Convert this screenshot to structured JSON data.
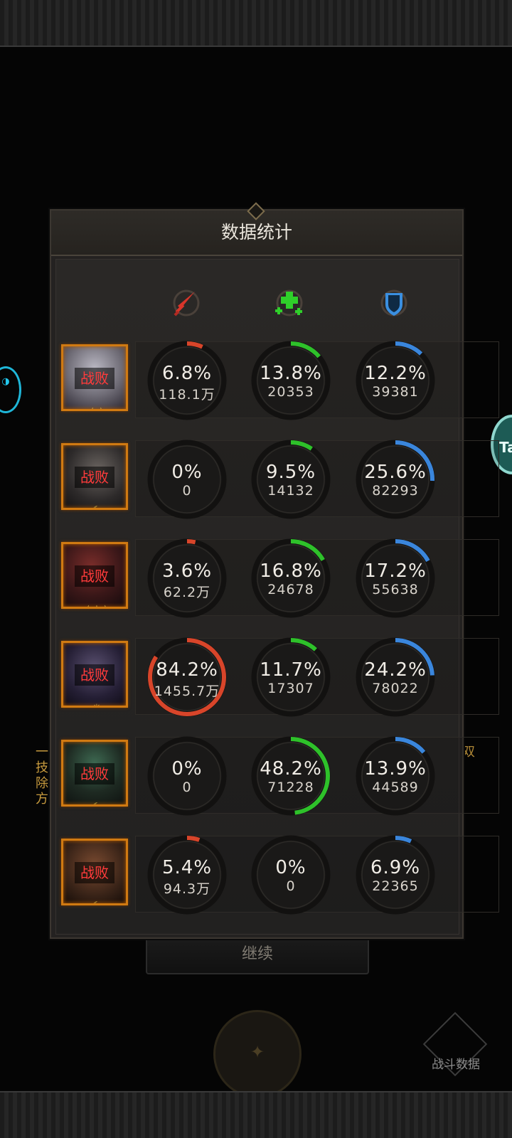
{
  "panel": {
    "title": "数据统计"
  },
  "columns": [
    {
      "icon": "damage-sword-icon",
      "color": "#d8352a"
    },
    {
      "icon": "heal-cross-icon",
      "color": "#2fcf2a"
    },
    {
      "icon": "shield-defense-icon",
      "color": "#3a8fe0"
    }
  ],
  "colors": {
    "damage": "#d8452a",
    "heal": "#2ec12a",
    "defense": "#3a86dc",
    "defeat_text": "#ff3b3b",
    "frame": "#d07a12"
  },
  "rows": [
    {
      "status": "战败",
      "rank": "☆☆",
      "stats": [
        {
          "pct": "6.8%",
          "val": "118.1万",
          "frac": 0.068
        },
        {
          "pct": "13.8%",
          "val": "20353",
          "frac": 0.138
        },
        {
          "pct": "12.2%",
          "val": "39381",
          "frac": 0.122
        }
      ]
    },
    {
      "status": "战败",
      "rank": "☾",
      "stats": [
        {
          "pct": "0%",
          "val": "0",
          "frac": 0
        },
        {
          "pct": "9.5%",
          "val": "14132",
          "frac": 0.095
        },
        {
          "pct": "25.6%",
          "val": "82293",
          "frac": 0.256
        }
      ]
    },
    {
      "status": "战败",
      "rank": "☆☆☆",
      "stats": [
        {
          "pct": "3.6%",
          "val": "62.2万",
          "frac": 0.036
        },
        {
          "pct": "16.8%",
          "val": "24678",
          "frac": 0.168
        },
        {
          "pct": "17.2%",
          "val": "55638",
          "frac": 0.172
        }
      ]
    },
    {
      "status": "战败",
      "rank": "☼",
      "stats": [
        {
          "pct": "84.2%",
          "val": "1455.7万",
          "frac": 0.842
        },
        {
          "pct": "11.7%",
          "val": "17307",
          "frac": 0.117
        },
        {
          "pct": "24.2%",
          "val": "78022",
          "frac": 0.242
        }
      ]
    },
    {
      "status": "战败",
      "rank": "☾",
      "stats": [
        {
          "pct": "0%",
          "val": "0",
          "frac": 0
        },
        {
          "pct": "48.2%",
          "val": "71228",
          "frac": 0.482
        },
        {
          "pct": "13.9%",
          "val": "44589",
          "frac": 0.139
        }
      ]
    },
    {
      "status": "战败",
      "rank": "☾",
      "stats": [
        {
          "pct": "5.4%",
          "val": "94.3万",
          "frac": 0.054
        },
        {
          "pct": "0%",
          "val": "0",
          "frac": 0
        },
        {
          "pct": "6.9%",
          "val": "22365",
          "frac": 0.069
        }
      ]
    }
  ],
  "footer": {
    "continue_label": "继续",
    "battle_data_label": "战斗数据"
  },
  "background": {
    "left_lines": [
      "一",
      "技",
      "除",
      "方"
    ],
    "right_lines": [
      "",
      "",
      "双",
      ""
    ],
    "right_badge": "Ta"
  }
}
